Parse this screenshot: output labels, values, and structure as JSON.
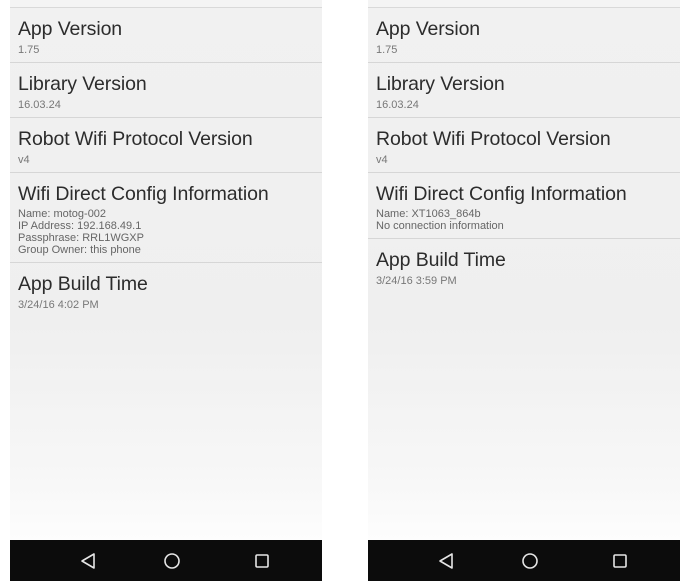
{
  "phones": [
    {
      "rows": [
        {
          "title": "App Version",
          "value": "1.75"
        },
        {
          "title": "Library Version",
          "value": "16.03.24"
        },
        {
          "title": "Robot Wifi Protocol Version",
          "value": "v4"
        },
        {
          "title": "Wifi Direct Config Information",
          "lines": [
            "Name: motog-002",
            "IP Address: 192.168.49.1",
            "Passphrase: RRL1WGXP",
            "Group Owner: this phone"
          ]
        },
        {
          "title": "App Build Time",
          "value": "3/24/16 4:02 PM"
        }
      ]
    },
    {
      "rows": [
        {
          "title": "App Version",
          "value": "1.75"
        },
        {
          "title": "Library Version",
          "value": "16.03.24"
        },
        {
          "title": "Robot Wifi Protocol Version",
          "value": "v4"
        },
        {
          "title": "Wifi Direct Config Information",
          "lines": [
            "Name: XT1063_864b",
            "No connection information"
          ]
        },
        {
          "title": "App Build Time",
          "value": "3/24/16 3:59 PM"
        }
      ]
    }
  ],
  "navbar": {
    "icons": [
      "back-icon",
      "home-icon",
      "recents-icon"
    ],
    "background": "#0c0c0c",
    "icon_color": "#e6e6e6"
  },
  "colors": {
    "title_text": "#2c2c2c",
    "subtitle_text": "#777777",
    "divider": "#d6d6d6",
    "screen_background": "#f1f1f1"
  }
}
